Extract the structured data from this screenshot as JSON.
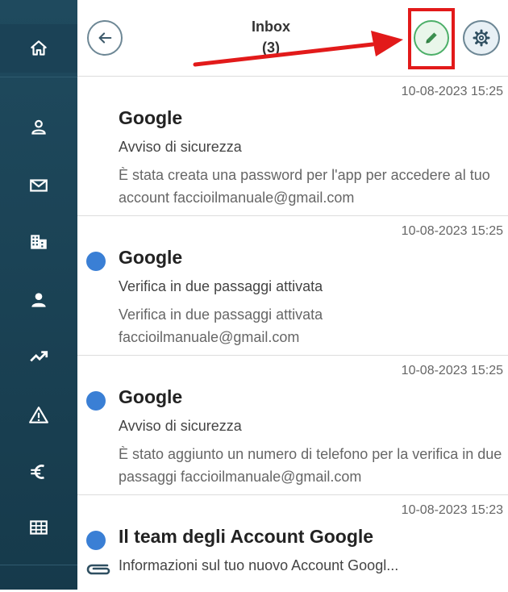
{
  "header": {
    "title_line1": "Inbox",
    "title_line2": "(3)"
  },
  "sidebar": {
    "items": [
      {
        "icon": "home-icon"
      },
      {
        "icon": "profile-icon"
      },
      {
        "icon": "mail-icon"
      },
      {
        "icon": "building-icon"
      },
      {
        "icon": "person-icon"
      },
      {
        "icon": "trending-icon"
      },
      {
        "icon": "warning-icon"
      },
      {
        "icon": "euro-icon"
      },
      {
        "icon": "table-icon"
      }
    ]
  },
  "messages": [
    {
      "date": "10-08-2023 15:25",
      "sender": "Google",
      "subject": "Avviso di sicurezza",
      "preview": "È stata creata una password per l'app per accedere al tuo account faccioilmanuale@gmail.com",
      "unread": false
    },
    {
      "date": "10-08-2023 15:25",
      "sender": "Google",
      "subject": "Verifica in due passaggi attivata",
      "preview": "Verifica in due passaggi attivata faccioilmanuale@gmail.com",
      "unread": true
    },
    {
      "date": "10-08-2023 15:25",
      "sender": "Google",
      "subject": "Avviso di sicurezza",
      "preview": "È stato aggiunto un numero di telefono per la verifica in due passaggi faccioilmanuale@gmail.com",
      "unread": true
    },
    {
      "date": "10-08-2023 15:23",
      "sender": "Il team degli Account Google",
      "subject": "Informazioni sul tuo nuovo Account Googl...",
      "preview": "",
      "unread": true,
      "attachment": true
    }
  ],
  "colors": {
    "sidebar": "#1f4a5e",
    "accent_green": "#4caf68",
    "unread_dot": "#3a7fd5",
    "annotation_red": "#e21a1a"
  }
}
